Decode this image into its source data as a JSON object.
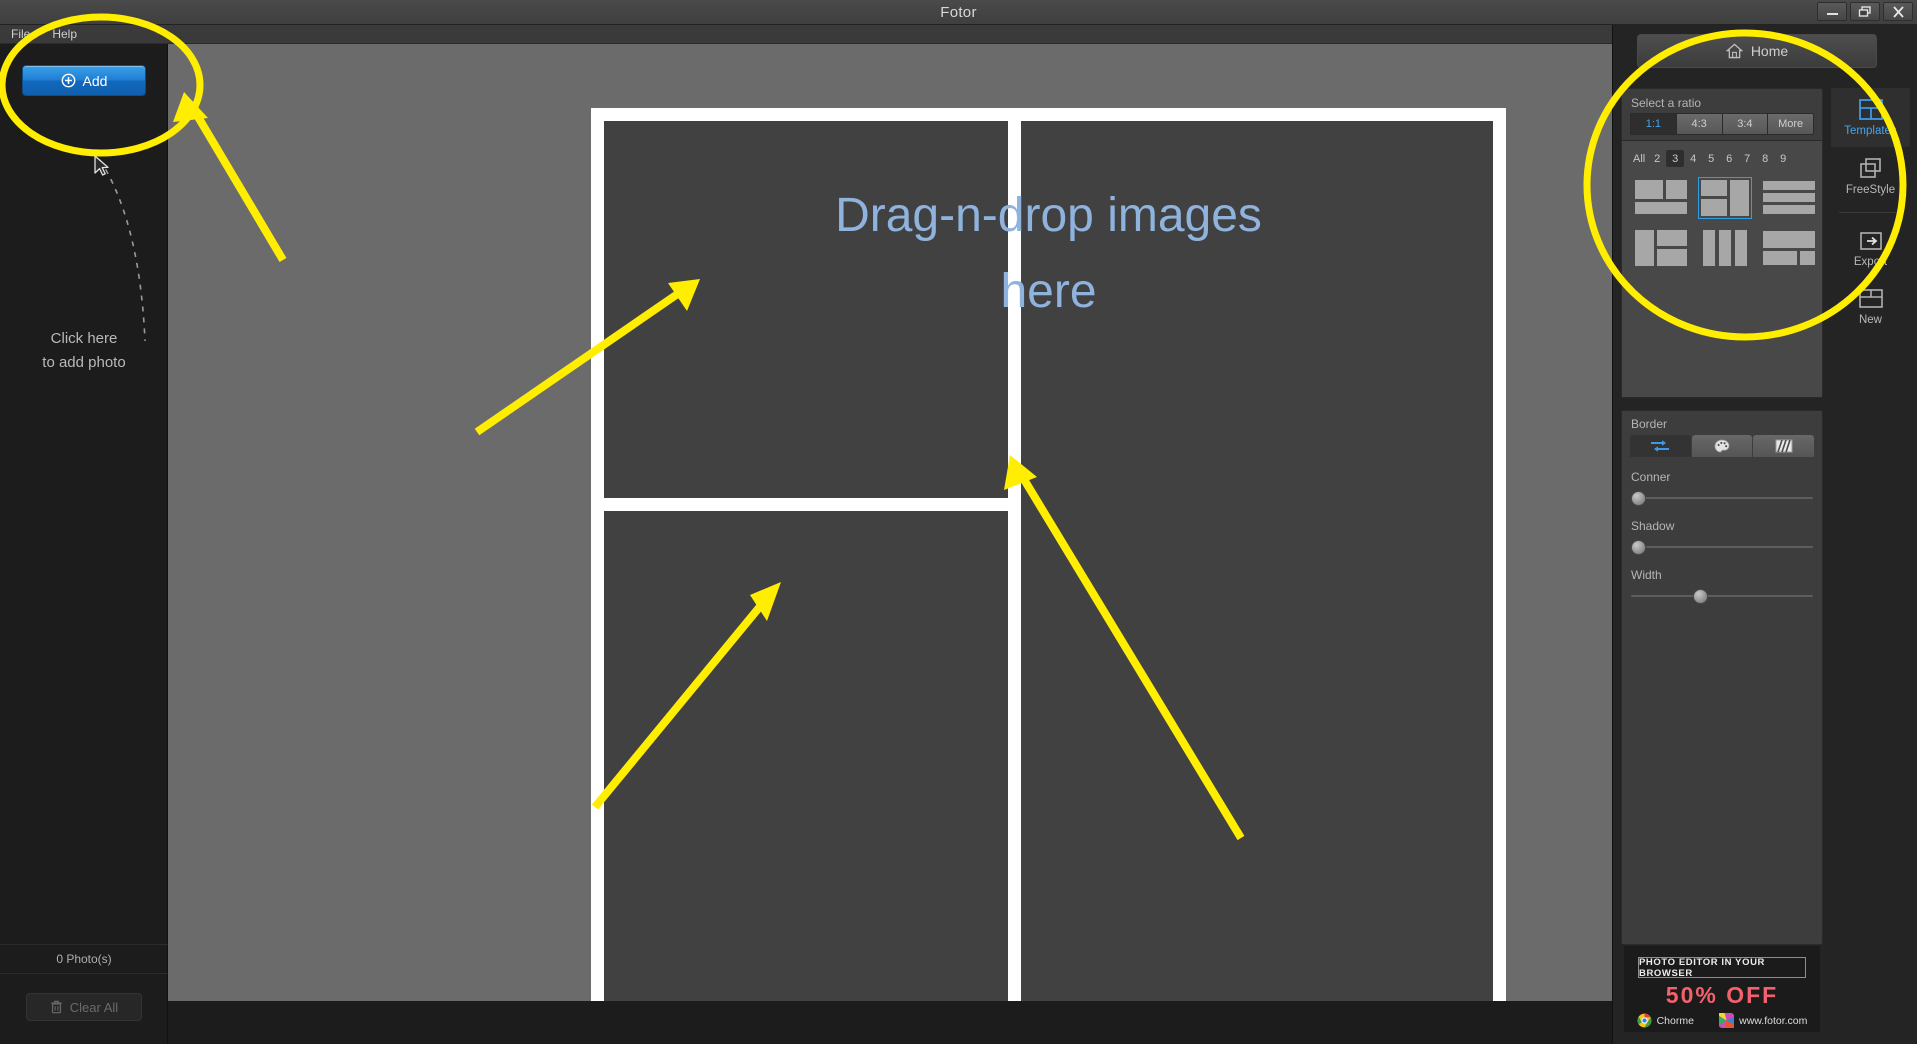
{
  "window": {
    "title": "Fotor",
    "minimize_label": "Minimize",
    "maximize_label": "Restore",
    "close_label": "Close"
  },
  "menubar": {
    "items": [
      {
        "label": "File"
      },
      {
        "label": "Help"
      }
    ]
  },
  "sidebar": {
    "add_button_label": "Add",
    "add_icon": "plus-circle-icon",
    "hint_line1": "Click here",
    "hint_line2": "to add photo",
    "photo_count": "0 Photo(s)",
    "clear_all_label": "Clear All",
    "clear_all_icon": "trash-icon"
  },
  "canvas": {
    "drop_message_line1": "Drag-n-drop images",
    "drop_message_line2": "here",
    "cells": 3,
    "background": "#ffffff",
    "cell_color": "#414141",
    "text_color": "#8fb3dd"
  },
  "right_panel": {
    "home_label": "Home",
    "home_icon": "home-icon",
    "templates": {
      "title": "Select a ratio",
      "ratios": [
        {
          "label": "1:1",
          "active": true
        },
        {
          "label": "4:3",
          "active": false
        },
        {
          "label": "3:4",
          "active": false
        },
        {
          "label": "More",
          "active": false
        }
      ],
      "counts": [
        {
          "label": "All",
          "active": false
        },
        {
          "label": "2",
          "active": false
        },
        {
          "label": "3",
          "active": true
        },
        {
          "label": "4",
          "active": false
        },
        {
          "label": "5",
          "active": false
        },
        {
          "label": "6",
          "active": false
        },
        {
          "label": "7",
          "active": false
        },
        {
          "label": "8",
          "active": false
        },
        {
          "label": "9",
          "active": false
        }
      ],
      "layout_thumbs": [
        {
          "name": "layout-two-top-one-bottom",
          "selected": false
        },
        {
          "name": "layout-two-left-one-right",
          "selected": true
        },
        {
          "name": "layout-three-rows",
          "selected": false
        },
        {
          "name": "layout-one-left-two-right",
          "selected": false
        },
        {
          "name": "layout-three-columns",
          "selected": false
        },
        {
          "name": "layout-one-top-two-bottom",
          "selected": false
        }
      ]
    },
    "border": {
      "title": "Border",
      "tabs": [
        {
          "name": "sliders-icon",
          "active": true
        },
        {
          "name": "palette-icon",
          "active": false
        },
        {
          "name": "pattern-icon",
          "active": false
        }
      ],
      "sliders": [
        {
          "label": "Conner",
          "value": 0
        },
        {
          "label": "Shadow",
          "value": 0
        },
        {
          "label": "Width",
          "value": 38
        }
      ]
    },
    "rail": [
      {
        "label": "Templates",
        "icon": "templates-icon",
        "active": true
      },
      {
        "label": "FreeStyle",
        "icon": "freestyle-icon",
        "active": false
      },
      {
        "label": "Export",
        "icon": "export-icon",
        "active": false
      },
      {
        "label": "New",
        "icon": "new-icon",
        "active": false
      }
    ],
    "promo": {
      "headline": "PHOTO EDITOR IN YOUR BROWSER",
      "offer": "50%  OFF",
      "browser_label": "Chorme",
      "site_label": "www.fotor.com",
      "offer_color": "#f4616c"
    }
  },
  "annotations": {
    "highlight_color": "#ffee00",
    "ellipses": [
      {
        "name": "add-button-highlight"
      },
      {
        "name": "templates-panel-highlight"
      }
    ],
    "arrows": [
      {
        "name": "arrow-to-add-button"
      },
      {
        "name": "arrow-to-cell-top-left"
      },
      {
        "name": "arrow-to-cell-bottom-left"
      },
      {
        "name": "arrow-to-cell-right"
      }
    ]
  }
}
